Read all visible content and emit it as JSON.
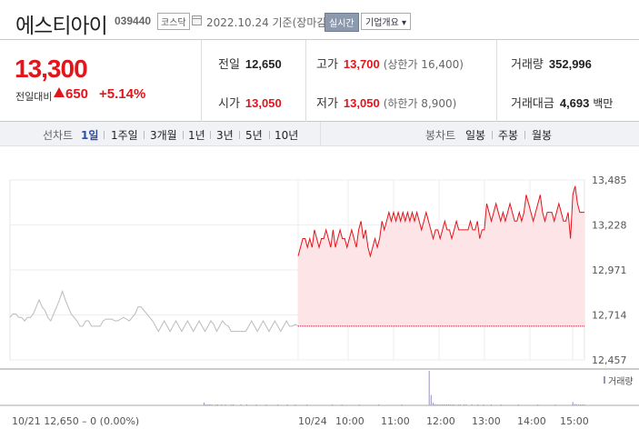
{
  "header": {
    "name": "에스티아이",
    "code": "039440",
    "market": "코스닥",
    "date_text": "2022.10.24 기준(장마감)",
    "realtime_label": "실시간",
    "company_label": "기업개요 ▾"
  },
  "price": {
    "current": "13,300",
    "change_label": "전일대비",
    "change_value": "650",
    "change_rate": "+5.14%"
  },
  "stats": {
    "prev_close_label": "전일",
    "prev_close": "12,650",
    "high_label": "고가",
    "high": "13,700",
    "upper_limit": "(상한가 16,400)",
    "volume_label": "거래량",
    "volume": "352,996",
    "open_label": "시가",
    "open": "13,050",
    "low_label": "저가",
    "low": "13,050",
    "lower_limit": "(하한가 8,900)",
    "amount_label": "거래대금",
    "amount": "4,693",
    "amount_unit": "백만"
  },
  "toolbar": {
    "line_label": "선차트",
    "line_periods": [
      "1일",
      "1주일",
      "3개월",
      "1년",
      "3년",
      "5년",
      "10년"
    ],
    "active_period": "1일",
    "candle_label": "봉차트",
    "candle_periods": [
      "일봉",
      "주봉",
      "월봉"
    ]
  },
  "colors": {
    "up": "#e1151b",
    "fill": "#fde4e6",
    "prev": "#bbbbbb",
    "volume": "#9a8fc2"
  },
  "chart_data": {
    "type": "line",
    "y_ticks": [
      "13,485",
      "13,228",
      "12,971",
      "12,714",
      "12,457"
    ],
    "y_tick_values": [
      13485,
      13228,
      12971,
      12714,
      12457
    ],
    "ylim": [
      12457,
      13485
    ],
    "baseline": 12650,
    "x_labels": [
      "10/24",
      "10:00",
      "11:00",
      "12:00",
      "13:00",
      "14:00",
      "15:00"
    ],
    "volume_label": "거래량",
    "prev_day_label": "10/21  12,650 – 0 (0.00%)",
    "series": [
      {
        "day": "10/21",
        "values": [
          12700,
          12720,
          12720,
          12700,
          12700,
          12680,
          12700,
          12700,
          12720,
          12760,
          12800,
          12760,
          12740,
          12700,
          12680,
          12720,
          12760,
          12800,
          12850,
          12800,
          12760,
          12720,
          12700,
          12680,
          12650,
          12650,
          12680,
          12680,
          12650,
          12650,
          12650,
          12650,
          12680,
          12690,
          12690,
          12690,
          12680,
          12680,
          12690,
          12700,
          12690,
          12680,
          12700,
          12720,
          12760,
          12760,
          12740,
          12720,
          12700,
          12680,
          12650,
          12620,
          12650,
          12680,
          12650,
          12620,
          12650,
          12680,
          12650,
          12620,
          12650,
          12680,
          12650,
          12620,
          12650,
          12680,
          12650,
          12620,
          12650,
          12680,
          12660,
          12620,
          12650,
          12680,
          12660,
          12650,
          12620,
          12620,
          12620,
          12620,
          12620,
          12620,
          12650,
          12680,
          12650,
          12620,
          12650,
          12680,
          12650,
          12620,
          12650,
          12680,
          12650,
          12620,
          12650,
          12680,
          12650,
          12650,
          12660,
          12650
        ]
      },
      {
        "day": "10/24",
        "values": [
          13050,
          13100,
          13150,
          13150,
          13100,
          13150,
          13100,
          13200,
          13150,
          13100,
          13150,
          13150,
          13200,
          13150,
          13100,
          13200,
          13100,
          13150,
          13200,
          13150,
          13150,
          13100,
          13150,
          13200,
          13150,
          13100,
          13200,
          13250,
          13150,
          13200,
          13100,
          13050,
          13100,
          13150,
          13100,
          13150,
          13250,
          13200,
          13250,
          13300,
          13250,
          13300,
          13250,
          13300,
          13250,
          13300,
          13250,
          13300,
          13250,
          13300,
          13250,
          13300,
          13250,
          13200,
          13250,
          13300,
          13250,
          13200,
          13150,
          13200,
          13200,
          13150,
          13200,
          13250,
          13200,
          13200,
          13150,
          13200,
          13250,
          13200,
          13200,
          13200,
          13200,
          13200,
          13250,
          13200,
          13200,
          13250,
          13150,
          13200,
          13200,
          13350,
          13300,
          13250,
          13300,
          13350,
          13300,
          13250,
          13300,
          13250,
          13300,
          13350,
          13300,
          13250,
          13250,
          13300,
          13250,
          13300,
          13400,
          13350,
          13300,
          13250,
          13300,
          13350,
          13400,
          13300,
          13250,
          13300,
          13300,
          13300,
          13250,
          13300,
          13350,
          13300,
          13250,
          13250,
          13300,
          13150,
          13400,
          13450,
          13350,
          13300,
          13300,
          13300
        ]
      }
    ],
    "volume": [
      0,
      0,
      0,
      0,
      0,
      0,
      0,
      0,
      0,
      0,
      0,
      0,
      0,
      0,
      0,
      0,
      0,
      0,
      0,
      0,
      0,
      0,
      0,
      0,
      0,
      0,
      0,
      0,
      0,
      0,
      0,
      0,
      0,
      0,
      0,
      0,
      0,
      0,
      0,
      0,
      0,
      0,
      0,
      0,
      0,
      0,
      0,
      0,
      0,
      0,
      0,
      0,
      0,
      0,
      0,
      0,
      0,
      0,
      0,
      0,
      0,
      0,
      0,
      0,
      0,
      0,
      0,
      0,
      0,
      0,
      0,
      0,
      0,
      0,
      0,
      0,
      0,
      0,
      0,
      0,
      0,
      0,
      0,
      0,
      0,
      0,
      0,
      0,
      0,
      0,
      0,
      0,
      0,
      0,
      0,
      0,
      0,
      0,
      0,
      0,
      8,
      2,
      1,
      3,
      1,
      0,
      1,
      2,
      0,
      1,
      0,
      1,
      0,
      0,
      1,
      1,
      0,
      0,
      0,
      1,
      0,
      0,
      1,
      0,
      0,
      0,
      0,
      1,
      0,
      0,
      0,
      0,
      1,
      0,
      0,
      0,
      0,
      0,
      1,
      0,
      0,
      0,
      0,
      1,
      0,
      0,
      0,
      1,
      0,
      0,
      0,
      0,
      0,
      1,
      0,
      0,
      0,
      0,
      0,
      0,
      0,
      0,
      0,
      0,
      0,
      0,
      1,
      0,
      0,
      0,
      0,
      1,
      0,
      0,
      0,
      0,
      0,
      0,
      0,
      0,
      1,
      0,
      0,
      0,
      0,
      0,
      0,
      0,
      0,
      0,
      1,
      0,
      0,
      0,
      0,
      0,
      0,
      0,
      0,
      0,
      0,
      0,
      1,
      0,
      0,
      0,
      0,
      0,
      0,
      0,
      0,
      0,
      0,
      0,
      0,
      0,
      100,
      30,
      8,
      4,
      3,
      2,
      2,
      1,
      1,
      1,
      2,
      1,
      1,
      1,
      0,
      1,
      1,
      0,
      1,
      1,
      0,
      0,
      1,
      0,
      0,
      1,
      0,
      0,
      1,
      0,
      0,
      0,
      1,
      0,
      0,
      0,
      0,
      1,
      0,
      0,
      0,
      0,
      0,
      0,
      0,
      0,
      1,
      0,
      0,
      0,
      0,
      0,
      0,
      0,
      0,
      0,
      1,
      0,
      0,
      0,
      0,
      0,
      0,
      0,
      0,
      1,
      0,
      0,
      0,
      0,
      0,
      0,
      0,
      0,
      10,
      4,
      3,
      2,
      1,
      1,
      1
    ]
  }
}
